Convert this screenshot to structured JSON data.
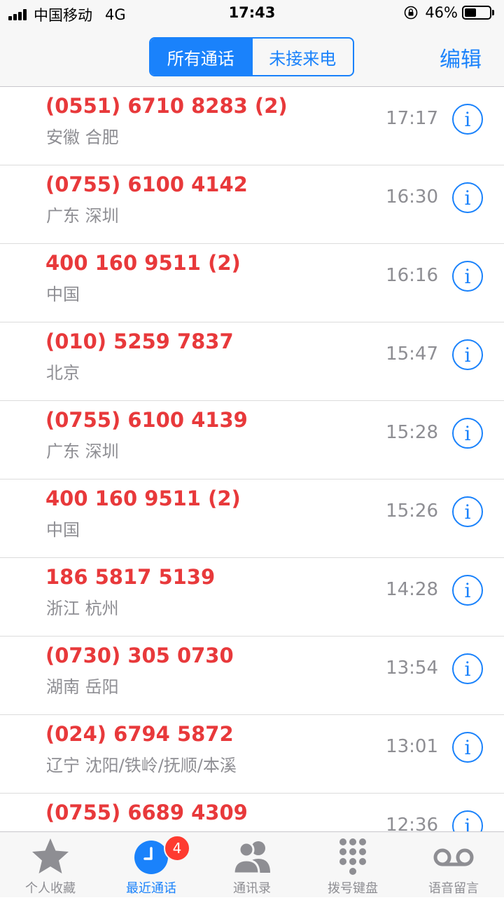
{
  "status_bar": {
    "carrier": "中国移动",
    "network": "4G",
    "time": "17:43",
    "battery_percent": "46%",
    "battery_level": 0.46
  },
  "nav": {
    "segments": [
      "所有通话",
      "未接来电"
    ],
    "selected_segment": "所有通话",
    "edit_label": "编辑"
  },
  "calls": [
    {
      "number": "(0551) 6710 8283 (2)",
      "location": "安徽 合肥",
      "time": "17:17"
    },
    {
      "number": "(0755) 6100 4142",
      "location": "广东 深圳",
      "time": "16:30"
    },
    {
      "number": "400 160 9511 (2)",
      "location": "中国",
      "time": "16:16"
    },
    {
      "number": "(010) 5259 7837",
      "location": "北京",
      "time": "15:47"
    },
    {
      "number": "(0755) 6100 4139",
      "location": "广东 深圳",
      "time": "15:28"
    },
    {
      "number": "400 160 9511 (2)",
      "location": "中国",
      "time": "15:26"
    },
    {
      "number": "186 5817 5139",
      "location": "浙江 杭州",
      "time": "14:28"
    },
    {
      "number": "(0730) 305 0730",
      "location": "湖南 岳阳",
      "time": "13:54"
    },
    {
      "number": "(024) 6794 5872",
      "location": "辽宁 沈阳/铁岭/抚顺/本溪",
      "time": "13:01"
    },
    {
      "number": "(0755) 6689 4309",
      "location": "",
      "time": "12:36"
    }
  ],
  "info_icon_glyph": "i",
  "tabs": [
    {
      "label": "个人收藏",
      "icon": "star-icon"
    },
    {
      "label": "最近通话",
      "icon": "clock-icon",
      "badge": "4",
      "active": true
    },
    {
      "label": "通讯录",
      "icon": "contacts-icon"
    },
    {
      "label": "拨号键盘",
      "icon": "keypad-icon"
    },
    {
      "label": "语音留言",
      "icon": "voicemail-icon"
    }
  ],
  "colors": {
    "accent": "#1a82fb",
    "missed_call": "#e8393b",
    "secondary_text": "#8e8e93",
    "badge": "#fe3b30"
  }
}
